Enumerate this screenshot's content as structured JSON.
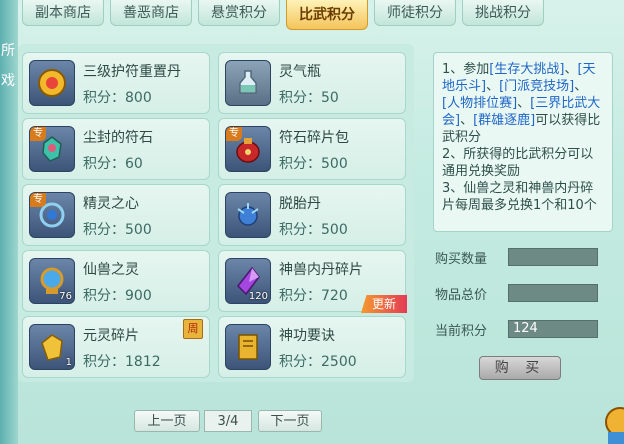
{
  "tabs": [
    {
      "label": "副本商店",
      "active": false
    },
    {
      "label": "善恶商店",
      "active": false
    },
    {
      "label": "悬赏积分",
      "active": false
    },
    {
      "label": "比武积分",
      "active": true
    },
    {
      "label": "师徒积分",
      "active": false
    },
    {
      "label": "挑战积分",
      "active": false
    }
  ],
  "items": [
    {
      "name": "三级护符重置丹",
      "points": "积分：800",
      "icon": "gold-amulet-icon",
      "count": ""
    },
    {
      "name": "灵气瓶",
      "points": "积分：50",
      "icon": "spirit-bottle-icon",
      "count": ""
    },
    {
      "name": "尘封的符石",
      "points": "积分：60",
      "icon": "rune-stone-icon",
      "count": "",
      "zhuan": "专"
    },
    {
      "name": "符石碎片包",
      "points": "积分：500",
      "icon": "red-bag-icon",
      "count": "",
      "zhuan": "专"
    },
    {
      "name": "精灵之心",
      "points": "积分：500",
      "icon": "spirit-heart-icon",
      "count": "",
      "zhuan": "专"
    },
    {
      "name": "脱胎丹",
      "points": "积分：500",
      "icon": "blue-pill-icon",
      "count": ""
    },
    {
      "name": "仙兽之灵",
      "points": "积分：900",
      "icon": "blue-orb-icon",
      "count": "76"
    },
    {
      "name": "神兽内丹碎片",
      "points": "积分：720",
      "icon": "purple-crystal-icon",
      "count": "120",
      "new": "更新"
    },
    {
      "name": "元灵碎片",
      "points": "积分：1812",
      "icon": "gold-fragment-icon",
      "count": "1",
      "zhou": "周"
    },
    {
      "name": "神功要诀",
      "points": "积分：2500",
      "icon": "gold-book-icon",
      "count": ""
    }
  ],
  "pager": {
    "prev": "上一页",
    "page": "3/4",
    "next": "下一页"
  },
  "info_text_parts": [
    {
      "t": "1、参加",
      "c": "n"
    },
    {
      "t": "[生存大挑战]",
      "c": "b"
    },
    {
      "t": "、",
      "c": "n"
    },
    {
      "t": "[天地乐斗]",
      "c": "b"
    },
    {
      "t": "、",
      "c": "n"
    },
    {
      "t": "[门派竞技场]",
      "c": "b"
    },
    {
      "t": "、",
      "c": "n"
    },
    {
      "t": "[人物排位赛]",
      "c": "b"
    },
    {
      "t": "、",
      "c": "n"
    },
    {
      "t": "[三界比武大会]",
      "c": "b"
    },
    {
      "t": "、",
      "c": "n"
    },
    {
      "t": "[群雄逐鹿]",
      "c": "b"
    },
    {
      "t": "可以获得比武积分",
      "c": "n"
    },
    {
      "t": "\n2、所获得的比武积分可以通用兑换奖励",
      "c": "n"
    },
    {
      "t": "\n3、仙兽之灵和神兽内丹碎片每周最多兑换1个和10个",
      "c": "n"
    }
  ],
  "form": {
    "qty_label": "购买数量",
    "qty_value": "",
    "total_label": "物品总价",
    "total_value": "",
    "current_label": "当前积分",
    "current_value": "124"
  },
  "buy_label": "购 买",
  "side_chars": [
    "所",
    "戏"
  ],
  "colors": {
    "accent": "#f3c45a",
    "link": "#1f66c8",
    "new_tag": "#e43b57"
  }
}
